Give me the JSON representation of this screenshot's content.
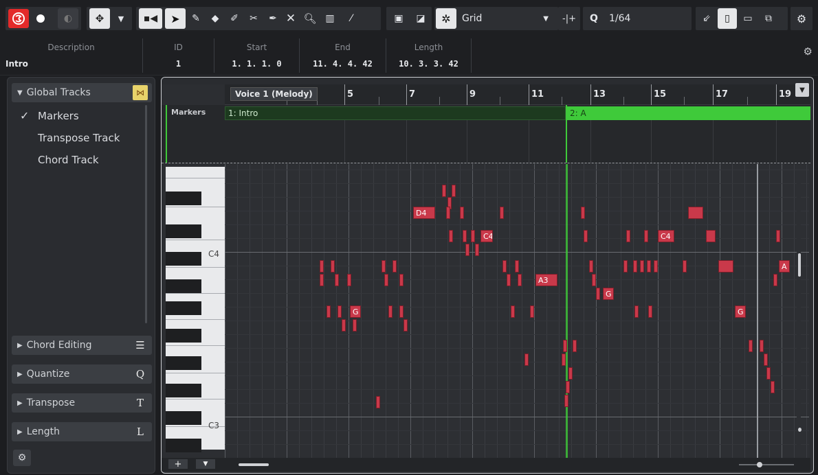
{
  "toolbar": {
    "snap_type": "Grid",
    "quantize_value": "1/64"
  },
  "info_line": {
    "columns": [
      {
        "label": "Description",
        "value": "Intro"
      },
      {
        "label": "ID",
        "value": "1"
      },
      {
        "label": "Start",
        "value": "1. 1. 1.  0"
      },
      {
        "label": "End",
        "value": "11. 4. 4. 42"
      },
      {
        "label": "Length",
        "value": "10. 3. 3. 42"
      }
    ]
  },
  "inspector": {
    "global_tracks": {
      "title": "Global Tracks",
      "items": [
        {
          "label": "Markers",
          "checked": "✓"
        },
        {
          "label": "Transpose Track",
          "checked": ""
        },
        {
          "label": "Chord Track",
          "checked": ""
        }
      ]
    },
    "sections": [
      {
        "label": "Chord Editing",
        "shortcut": ""
      },
      {
        "label": "Quantize",
        "shortcut": "Q"
      },
      {
        "label": "Transpose",
        "shortcut": "T"
      },
      {
        "label": "Length",
        "shortcut": "L"
      }
    ]
  },
  "editor": {
    "part_name": "Voice 1 (Melody)",
    "marker_lane_label": "Markers",
    "markers": [
      "1: Intro",
      "2: A"
    ],
    "ruler_numbers": [
      "5",
      "7",
      "9",
      "11",
      "13",
      "15",
      "17",
      "19"
    ],
    "piano_labels": [
      "C4",
      "C3"
    ],
    "note_labels": [
      "D4",
      "C4",
      "A3",
      "G",
      "C4",
      "G",
      "G",
      "A"
    ],
    "colors": {
      "note": "#c9394a",
      "marker_active": "#3fca3a",
      "marker_inactive": "#1d3a1f",
      "record": "#e32a2a",
      "accent": "#4a9bff"
    }
  }
}
